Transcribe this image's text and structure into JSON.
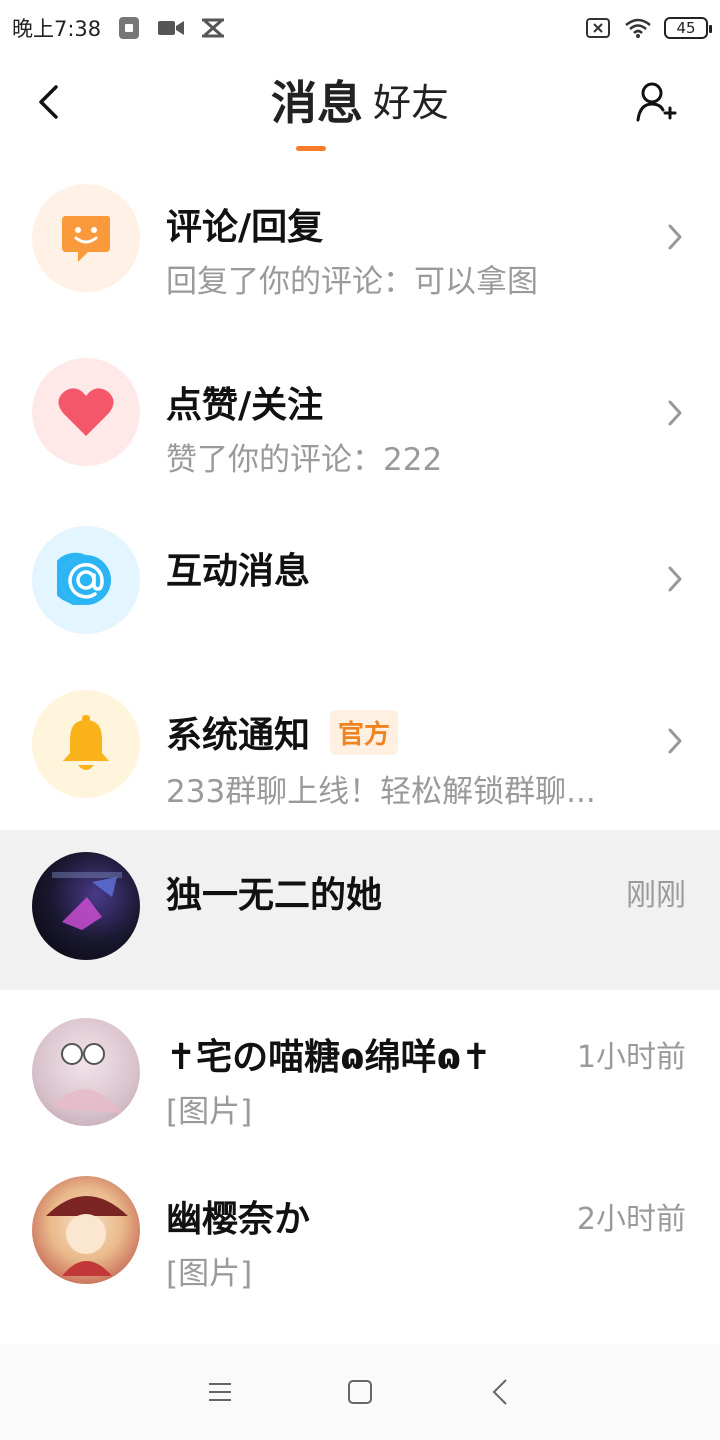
{
  "status_bar": {
    "time": "晚上7:38",
    "battery": "45"
  },
  "header": {
    "tabs": [
      {
        "label": "消息",
        "active": true
      },
      {
        "label": "好友",
        "active": false
      }
    ],
    "accent_color": "#fb7c2a"
  },
  "system_items": [
    {
      "title": "评论/回复",
      "subtitle": "回复了你的评论：可以拿图",
      "icon": "chat-smile-icon",
      "color": "#fb9a3c"
    },
    {
      "title": "点赞/关注",
      "subtitle": "赞了你的评论：222",
      "icon": "heart-icon",
      "color": "#f4566a"
    },
    {
      "title": "互动消息",
      "subtitle": "",
      "icon": "at-sign-icon",
      "color": "#2bb5f5"
    },
    {
      "title": "系统通知",
      "badge": "官方",
      "subtitle": "233群聊上线！轻松解锁群聊...",
      "icon": "bell-icon",
      "color": "#fbb31c"
    }
  ],
  "chats": [
    {
      "name": "独一无二的她",
      "preview": "",
      "time": "刚刚"
    },
    {
      "name": "✝宅の喵糖ɷ绵咩ɷ✝",
      "preview": "[图片]",
      "time": "1小时前"
    },
    {
      "name": "幽樱奈か",
      "preview": "[图片]",
      "time": "2小时前"
    }
  ]
}
